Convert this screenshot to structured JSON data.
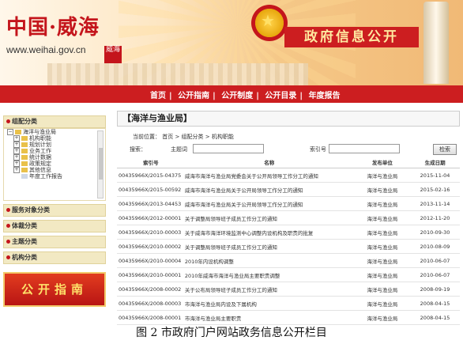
{
  "header": {
    "logo_text": "中国·威海",
    "url": "www.weihai.gov.cn",
    "banner": "政府信息公开"
  },
  "nav": {
    "items": [
      "首页",
      "公开指南",
      "公开制度",
      "公开目录",
      "年度报告"
    ],
    "separator": "|"
  },
  "sidebar": {
    "sections": [
      "组配分类",
      "服务对象分类",
      "体裁分类",
      "主题分类",
      "机构分类"
    ],
    "tree": [
      {
        "label": "海洋与渔业局",
        "level": 0
      },
      {
        "label": "机构职能",
        "level": 1
      },
      {
        "label": "规划计划",
        "level": 1
      },
      {
        "label": "业务工作",
        "level": 1
      },
      {
        "label": "统计数据",
        "level": 1
      },
      {
        "label": "政策规定",
        "level": 1
      },
      {
        "label": "其他信息",
        "level": 1
      },
      {
        "label": "年度工作报告",
        "level": 1
      }
    ],
    "promo": "公开指南"
  },
  "main": {
    "title": "【海洋与渔业局】",
    "breadcrumb": "当前位置： 首页 > 组配分类 > 机构职能",
    "search": {
      "label": "搜索：",
      "topic_label": "主题词",
      "index_label": "索引号",
      "button": "检索"
    },
    "columns": [
      "索引号",
      "名称",
      "发布单位",
      "生成日期"
    ],
    "rows": [
      [
        "00435966X/2015-04375",
        "威海市海洋与渔业局党委会关于公开局领导工作分工的通知",
        "海洋与渔业局",
        "2015-11-04"
      ],
      [
        "00435966X/2015-00592",
        "威海市海洋与渔业局关于公开局领导工作分工的通知",
        "海洋与渔业局",
        "2015-02-16"
      ],
      [
        "00435966X/2013-04453",
        "威海市海洋与渔业局关于公开局领导工作分工的通知",
        "海洋与渔业局",
        "2013-11-14"
      ],
      [
        "00435966X/2012-00001",
        "关于调整局领导班子成员工作分工的通知",
        "海洋与渔业局",
        "2012-11-20"
      ],
      [
        "00435966X/2010-00003",
        "关于威海市海洋环境监测中心调整内设机构及职责的批复",
        "海洋与渔业局",
        "2010-09-30"
      ],
      [
        "00435966X/2010-00002",
        "关于调整局领导班子成员工作分工的通知",
        "海洋与渔业局",
        "2010-08-09"
      ],
      [
        "00435966X/2010-00004",
        "2010年内设机构调整",
        "海洋与渔业局",
        "2010-06-07"
      ],
      [
        "00435966X/2010-00001",
        "2010年威海市海洋与渔业局主要职责调整",
        "海洋与渔业局",
        "2010-06-07"
      ],
      [
        "00435966X/2008-00002",
        "关于公布局领导班子成员工作分工的通知",
        "海洋与渔业局",
        "2008-09-19"
      ],
      [
        "00435966X/2008-00003",
        "市海洋与渔业局内设及下属机构",
        "海洋与渔业局",
        "2008-04-15"
      ],
      [
        "00435966X/2008-00001",
        "市海洋与渔业局主要职责",
        "海洋与渔业局",
        "2008-04-15"
      ]
    ]
  },
  "caption": "图 2 市政府门户网站政务信息公开栏目",
  "colors": {
    "brand_red": "#cc1e20",
    "header_bg": "#fde6c2"
  }
}
